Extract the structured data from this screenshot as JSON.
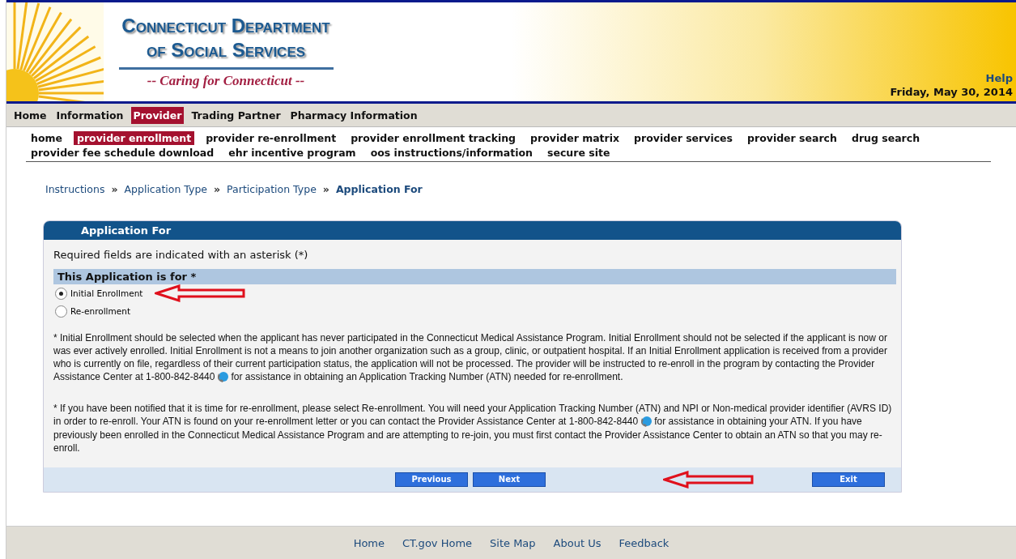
{
  "header": {
    "title_line_1": "Connecticut Department",
    "title_line_2": "of Social Services",
    "tagline": "-- Caring for Connecticut --",
    "help": "Help",
    "date": "Friday, May 30, 2014"
  },
  "main_nav": [
    {
      "label": "Home",
      "selected": false
    },
    {
      "label": "Information",
      "selected": false
    },
    {
      "label": "Provider",
      "selected": true
    },
    {
      "label": "Trading Partner",
      "selected": false
    },
    {
      "label": "Pharmacy Information",
      "selected": false
    }
  ],
  "sub_nav": [
    {
      "label": "home",
      "selected": false
    },
    {
      "label": "provider enrollment",
      "selected": true
    },
    {
      "label": "provider re-enrollment",
      "selected": false
    },
    {
      "label": "provider enrollment tracking",
      "selected": false
    },
    {
      "label": "provider matrix",
      "selected": false
    },
    {
      "label": "provider services",
      "selected": false
    },
    {
      "label": "provider search",
      "selected": false
    },
    {
      "label": "drug search",
      "selected": false
    },
    {
      "label": "provider fee schedule download",
      "selected": false
    },
    {
      "label": "ehr incentive program",
      "selected": false
    },
    {
      "label": "oos instructions/information",
      "selected": false
    },
    {
      "label": "secure site",
      "selected": false
    }
  ],
  "breadcrumb": [
    {
      "label": "Instructions",
      "selected": false
    },
    {
      "label": "Application Type",
      "selected": false
    },
    {
      "label": "Participation Type",
      "selected": false
    },
    {
      "label": "Application For",
      "selected": true
    }
  ],
  "breadcrumb_separator": "»",
  "panel": {
    "title": "Application For",
    "required_note": "Required fields are indicated with an asterisk (*)",
    "section_title": "This Application is for *",
    "options": [
      {
        "label": "Initial Enrollment",
        "selected": true,
        "annotated": true
      },
      {
        "label": "Re-enrollment",
        "selected": false,
        "annotated": false
      }
    ],
    "paragraphs": [
      {
        "text_before": "* Initial Enrollment should be selected when the applicant has never participated in the Connecticut Medical Assistance Program. Initial Enrollment should not be selected if the applicant is now or was ever actively enrolled. Initial Enrollment is not a means to join another organization such as a group, clinic, or outpatient hospital. If an Initial Enrollment application is received from a provider who is currently on file, regardless of their current participation status, the application will not be processed. The provider will be instructed to re-enroll in the program by contacting the Provider Assistance Center at 1-800-842-8440",
        "text_after": "for assistance in obtaining an Application Tracking Number (ATN) needed for re-enrollment."
      },
      {
        "text_before": "* If you have been notified that it is time for re-enrollment, please select Re-enrollment. You will need your Application Tracking Number (ATN) and NPI or Non-medical provider identifier (AVRS ID) in order to re-enroll. Your ATN is found on your re-enrollment letter or you can contact the Provider Assistance Center at 1-800-842-8440",
        "text_after": "for assistance in obtaining your ATN. If you have previously been enrolled in the Connecticut Medical Assistance Program and are attempting to re-join, you must first contact the Provider Assistance Center to obtain an ATN so that you may re-enroll."
      }
    ],
    "buttons": [
      {
        "label": "Previous",
        "kind": "previous",
        "annotated": false
      },
      {
        "label": "Next",
        "kind": "next",
        "annotated": true
      },
      {
        "label": "Exit",
        "kind": "exit",
        "annotated": false
      }
    ]
  },
  "footer_links": [
    "Home",
    "CT.gov Home",
    "Site Map",
    "About Us",
    "Feedback"
  ]
}
